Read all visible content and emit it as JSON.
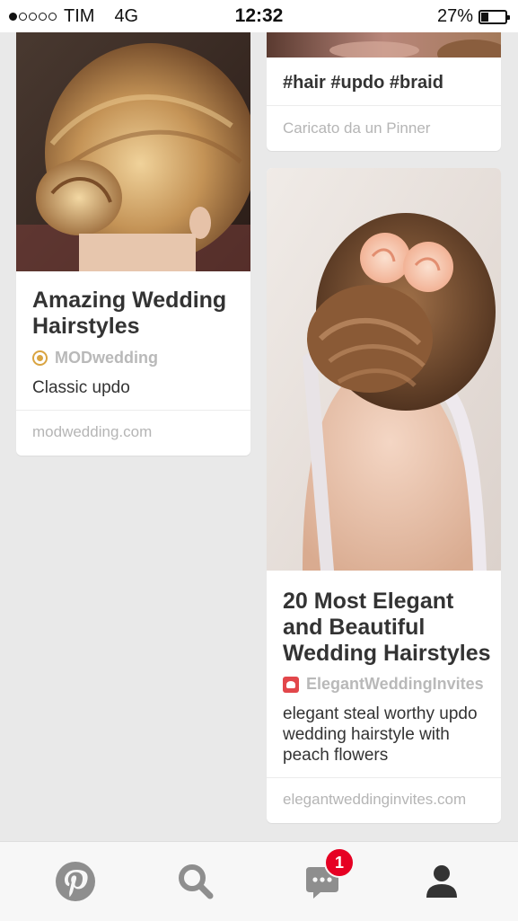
{
  "status_bar": {
    "carrier": "TIM",
    "network": "4G",
    "time": "12:32",
    "battery": "27%",
    "signal_strength": 1
  },
  "pins": [
    {
      "title": "Amazing Wedding Hairstyles",
      "pinner": "MODwedding",
      "description": "Classic updo",
      "source": "modwedding.com"
    },
    {
      "tags": "#hair #updo #braid",
      "uploaded_by": "Caricato da un Pinner"
    },
    {
      "title": "20 Most Elegant and Beautiful Wedding Hairstyles",
      "pinner": "ElegantWeddingInvites",
      "description": "elegant steal worthy updo wedding hairstyle with peach flowers",
      "source": "elegantweddinginvites.com"
    }
  ],
  "tab_bar": {
    "items": [
      "home-icon",
      "search-icon",
      "messages-icon",
      "profile-icon"
    ],
    "notification_count": "1"
  },
  "colors": {
    "brand": "#bd081c",
    "badge": "#e60023",
    "background": "#e9e9e9"
  }
}
